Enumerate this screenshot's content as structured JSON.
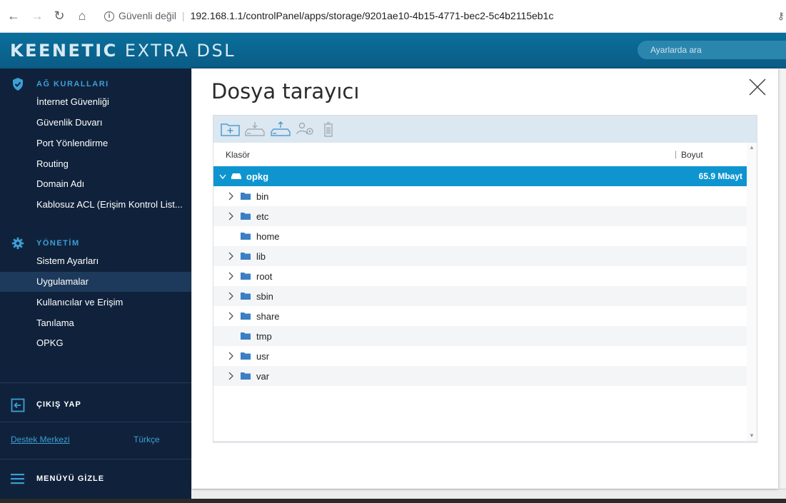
{
  "browser": {
    "security_label": "Güvenli değil",
    "url": "192.168.1.1/controlPanel/apps/storage/9201ae10-4b15-4771-bec2-5c4b2115eb1c"
  },
  "header": {
    "logo_main": "KEENETIC",
    "logo_model": "EXTRA DSL",
    "search_placeholder": "Ayarlarda ara"
  },
  "sidebar": {
    "section1_title": "AĞ KURALLARI",
    "section1_items": [
      "İnternet Güvenliği",
      "Güvenlik Duvarı",
      "Port Yönlendirme",
      "Routing",
      "Domain Adı",
      "Kablosuz ACL (Erişim Kontrol List..."
    ],
    "section2_title": "YÖNETİM",
    "section2_items": [
      "Sistem Ayarları",
      "Uygulamalar",
      "Kullanıcılar ve Erişim",
      "Tanılama",
      "OPKG"
    ],
    "active_item": "Uygulamalar",
    "logout": "ÇIKIŞ YAP",
    "support": "Destek Merkezi",
    "language": "Türkçe",
    "hide_menu": "MENÜYÜ GİZLE"
  },
  "modal": {
    "title": "Dosya tarayıcı",
    "columns": {
      "folder": "Klasör",
      "size": "Boyut"
    },
    "root": {
      "name": "opkg",
      "size": "65.9 Mbayt"
    },
    "folders": [
      {
        "name": "bin",
        "expandable": true
      },
      {
        "name": "etc",
        "expandable": true
      },
      {
        "name": "home",
        "expandable": false
      },
      {
        "name": "lib",
        "expandable": true
      },
      {
        "name": "root",
        "expandable": true
      },
      {
        "name": "sbin",
        "expandable": true
      },
      {
        "name": "share",
        "expandable": true
      },
      {
        "name": "tmp",
        "expandable": false
      },
      {
        "name": "usr",
        "expandable": true
      },
      {
        "name": "var",
        "expandable": true
      }
    ],
    "toolbar_icons": [
      "new-folder-icon",
      "download-icon",
      "upload-icon",
      "permissions-icon",
      "trash-icon"
    ]
  },
  "colors": {
    "accent": "#0e95d0",
    "sidebar_bg": "#10223b",
    "header_bg": "#0a6f9c"
  }
}
